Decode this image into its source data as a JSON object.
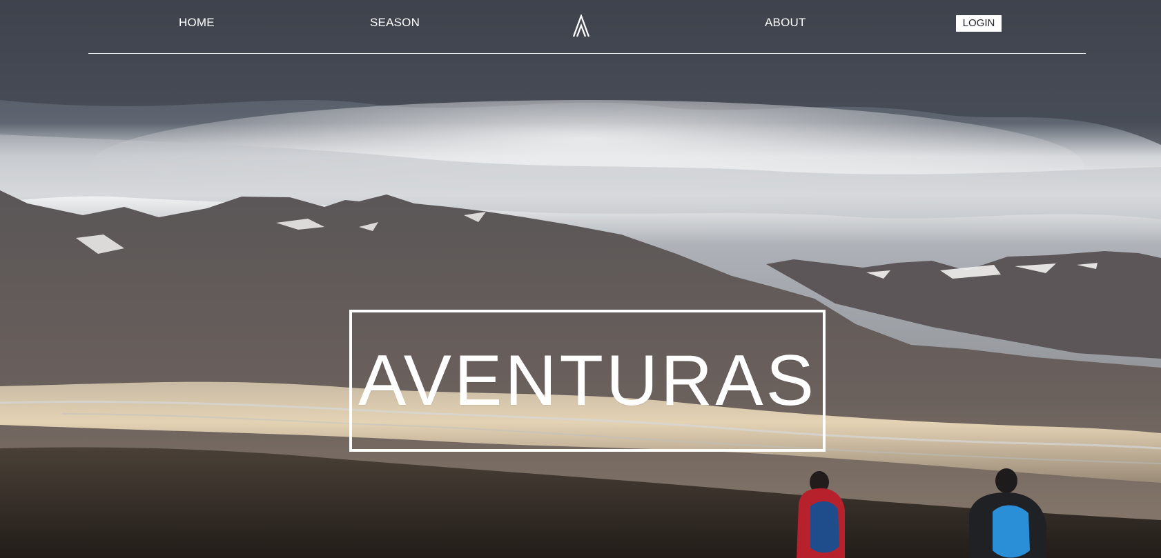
{
  "navigation": {
    "items": [
      {
        "label": "HOME"
      },
      {
        "label": "SEASON"
      },
      {
        "label": "ABOUT"
      }
    ],
    "login_label": "LOGIN",
    "logo_icon": "a-logo-icon"
  },
  "hero": {
    "title": "AVENTURAS"
  },
  "colors": {
    "text": "#ffffff",
    "button_background": "#ffffff",
    "button_text": "#1d1f22"
  }
}
